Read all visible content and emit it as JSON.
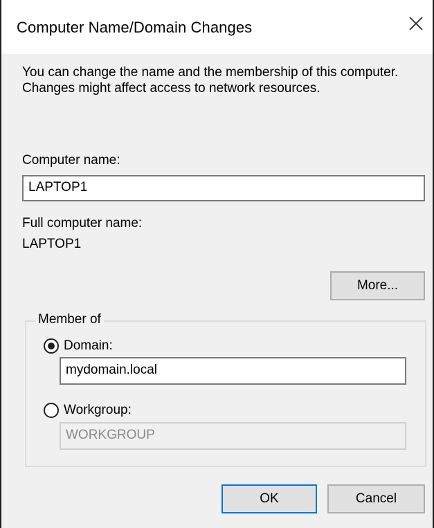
{
  "window": {
    "title": "Computer Name/Domain Changes",
    "close_icon": "close-icon"
  },
  "description": "You can change the name and the membership of this computer. Changes might affect access to network resources.",
  "computer_name": {
    "label": "Computer name:",
    "value": "LAPTOP1"
  },
  "full_computer_name": {
    "label": "Full computer name:",
    "value": "LAPTOP1"
  },
  "more_button": {
    "label": "More..."
  },
  "member_of": {
    "legend": "Member of",
    "selected": "domain",
    "domain": {
      "label": "Domain:",
      "value": "mydomain.local"
    },
    "workgroup": {
      "label": "Workgroup:",
      "value": "WORKGROUP"
    }
  },
  "footer": {
    "ok_label": "OK",
    "cancel_label": "Cancel"
  },
  "colors": {
    "accent": "#0078d7",
    "dialog_bg": "#f0f0f0",
    "titlebar_bg": "#ffffff"
  }
}
